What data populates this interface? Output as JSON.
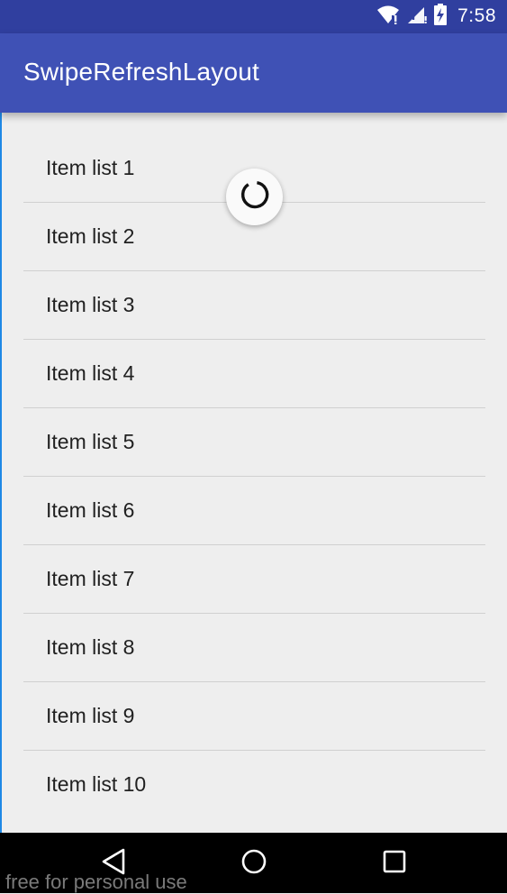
{
  "status_bar": {
    "time": "7:58",
    "icons": [
      "wifi-icon",
      "cellular-signal-icon",
      "battery-charging-icon"
    ],
    "color": "#303f9f"
  },
  "app_bar": {
    "title": "SwipeRefreshLayout",
    "color": "#3f51b5"
  },
  "refresh_indicator": {
    "icon": "refresh-spinner-icon",
    "state": "refreshing"
  },
  "list": {
    "items": [
      {
        "label": "Item list 1"
      },
      {
        "label": "Item list 2"
      },
      {
        "label": "Item list 3"
      },
      {
        "label": "Item list 4"
      },
      {
        "label": "Item list 5"
      },
      {
        "label": "Item list 6"
      },
      {
        "label": "Item list 7"
      },
      {
        "label": "Item list 8"
      },
      {
        "label": "Item list 9"
      },
      {
        "label": "Item list 10"
      }
    ]
  },
  "nav_bar": {
    "buttons": [
      "back-icon",
      "home-icon",
      "recents-icon"
    ]
  },
  "watermark": {
    "text": "free for personal use"
  }
}
